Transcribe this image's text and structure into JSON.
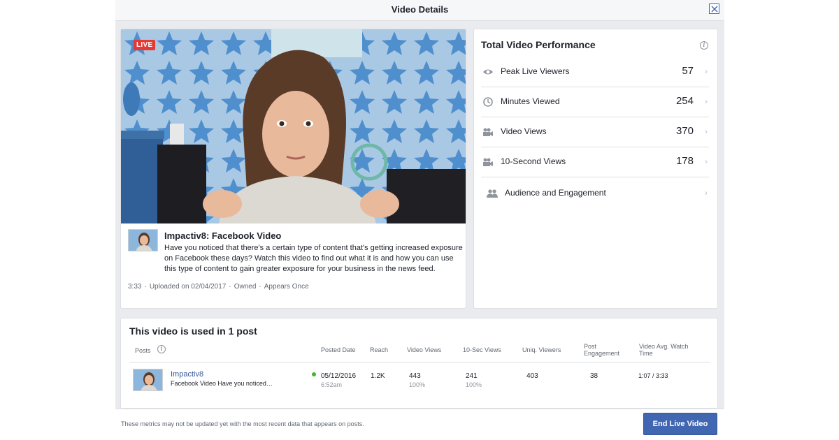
{
  "dialog": {
    "title": "Video Details"
  },
  "video": {
    "live_badge": "LIVE",
    "title": "Impactiv8: Facebook Video",
    "description": "Have you noticed that there's a certain type of content that's getting increased exposure on Facebook these days? Watch this video to find out what it is and how you can use this type of content to gain greater exposure for your business in the news feed.",
    "meta": {
      "duration": "3:33",
      "uploaded": "Uploaded on 02/04/2017",
      "owned": "Owned",
      "appears": "Appears Once"
    }
  },
  "performance": {
    "title": "Total Video Performance",
    "rows": [
      {
        "label": "Peak Live Viewers",
        "value": "57",
        "icon": "eye-icon"
      },
      {
        "label": "Minutes Viewed",
        "value": "254",
        "icon": "clock-icon"
      },
      {
        "label": "Video Views",
        "value": "370",
        "icon": "video-camera-icon"
      },
      {
        "label": "10-Second Views",
        "value": "178",
        "icon": "video-camera-icon"
      },
      {
        "label": "Audience and Engagement",
        "value": "",
        "icon": "people-icon"
      }
    ]
  },
  "posts": {
    "title": "This video is used in 1 post",
    "headers": {
      "posts": "Posts",
      "posted_date": "Posted Date",
      "reach": "Reach",
      "video_views": "Video Views",
      "ten_sec_views": "10-Sec Views",
      "uniq_viewers": "Uniq. Viewers",
      "post_engagement_1": "Post",
      "post_engagement_2": "Engagement",
      "avg_watch_1": "Video Avg. Watch",
      "avg_watch_2": "Time"
    },
    "row": {
      "page_name": "Impactiv8",
      "post_text": "Facebook Video Have you noticed…",
      "date": "05/12/2016",
      "time": "6:52am",
      "reach": "1.2K",
      "video_views": "443",
      "video_views_pct": "100%",
      "ten_sec_views": "241",
      "ten_sec_views_pct": "100%",
      "uniq_viewers": "403",
      "engagement": "38",
      "avg_watch": "1:07",
      "total_time": "/ 3:33"
    }
  },
  "footer": {
    "note": "These metrics may not be updated yet with the most recent data that appears on posts.",
    "end_button": "End Live Video"
  },
  "colors": {
    "accent": "#4267b2",
    "live": "#e53935",
    "link": "#365899",
    "status": "#42b72a"
  }
}
